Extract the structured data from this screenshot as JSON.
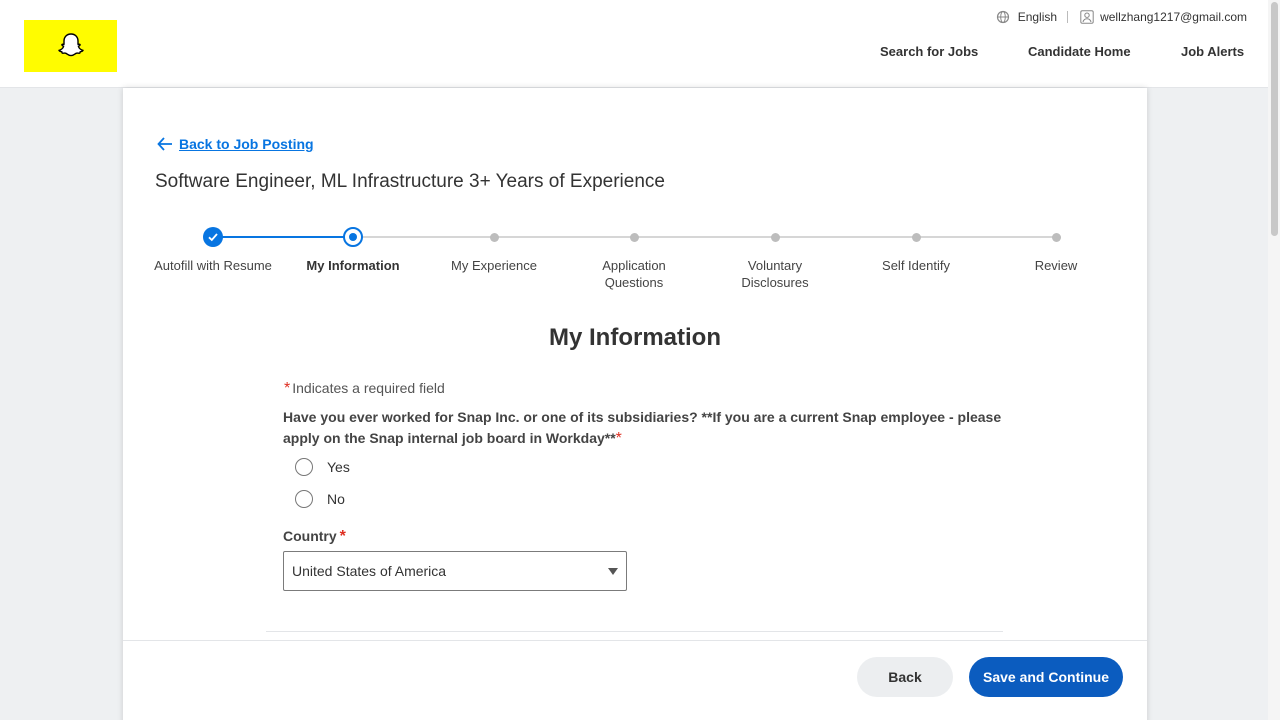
{
  "header": {
    "logo_name": "snapchat-ghost-logo",
    "language": "English",
    "user_email": "wellzhang1217@gmail.com",
    "nav": {
      "search_jobs": "Search for Jobs",
      "candidate_home": "Candidate Home",
      "job_alerts": "Job Alerts"
    }
  },
  "page": {
    "back_link": "Back to Job Posting",
    "job_title": "Software Engineer, ML Infrastructure 3+ Years of Experience"
  },
  "stepper": {
    "steps": [
      {
        "label": "Autofill with Resume",
        "state": "done"
      },
      {
        "label": "My Information",
        "state": "current"
      },
      {
        "label": "My Experience",
        "state": "upcoming"
      },
      {
        "label": "Application Questions",
        "state": "upcoming"
      },
      {
        "label": "Voluntary Disclosures",
        "state": "upcoming"
      },
      {
        "label": "Self Identify",
        "state": "upcoming"
      },
      {
        "label": "Review",
        "state": "upcoming"
      }
    ]
  },
  "form": {
    "section_title": "My Information",
    "required_note": "Indicates a required field",
    "required_marker": "*",
    "question": "Have you ever worked for Snap Inc. or one of its subsidiaries? **If you are a current Snap employee - please apply on the Snap internal job board in Workday**",
    "options": [
      "Yes",
      "No"
    ],
    "country_label": "Country",
    "country_value": "United States of America"
  },
  "footer": {
    "back_label": "Back",
    "save_label": "Save and Continue"
  },
  "colors": {
    "accent": "#0875e1",
    "primary_button": "#0b5cbf",
    "logo_bg": "#fffc00",
    "required": "#de2e21"
  }
}
